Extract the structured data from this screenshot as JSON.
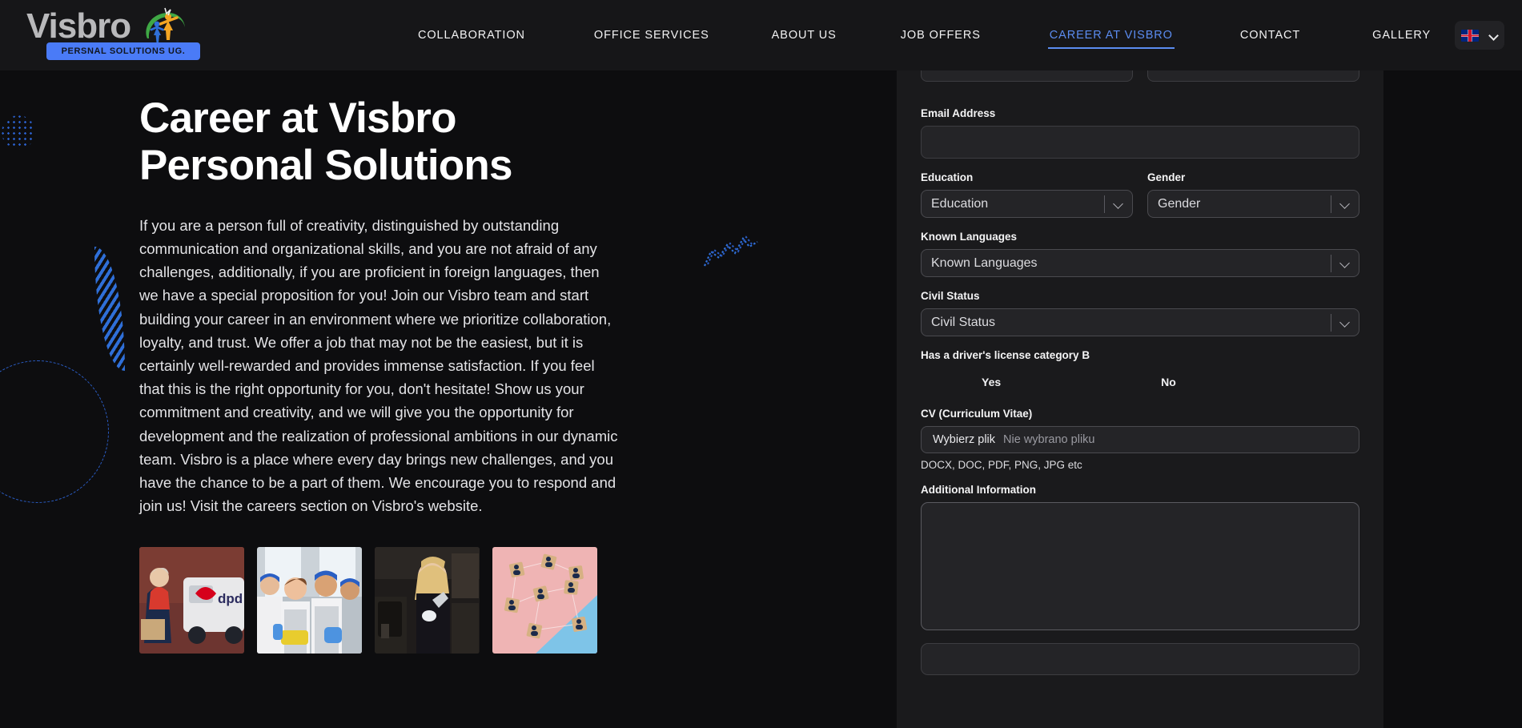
{
  "brand": {
    "logo_word": "Visbro",
    "logo_banner": "PERSNAL SOLUTIONS UG.",
    "accent_blue": "#4a7bf7",
    "active_nav_blue": "#5b8cf0"
  },
  "nav": {
    "items": [
      {
        "label": "COLLABORATION",
        "active": false
      },
      {
        "label": "OFFICE SERVICES",
        "active": false
      },
      {
        "label": "ABOUT US",
        "active": false
      },
      {
        "label": "JOB OFFERS",
        "active": false
      },
      {
        "label": "CAREER AT VISBRO",
        "active": true
      },
      {
        "label": "CONTACT",
        "active": false
      },
      {
        "label": "GALLERY",
        "active": false
      }
    ],
    "language": {
      "flag": "uk-flag-icon",
      "chevron": "chevron-down-icon"
    }
  },
  "hero": {
    "title": "Career at Visbro\nPersonal Solutions",
    "body": "If you are a person full of creativity, distinguished by outstanding communication and organizational skills, and you are not afraid of any challenges, additionally, if you are proficient in foreign languages, then we have a special proposition for you! Join our Visbro team and start building your career in an environment where we prioritize collaboration, loyalty, and trust. We offer a job that may not be the easiest, but it is certainly well-rewarded and provides immense satisfaction. If you feel that this is the right opportunity for you, don't hesitate! Show us your commitment and creativity, and we will give you the opportunity for development and the realization of professional ambitions in our dynamic team. Visbro is a place where every day brings new challenges, and you have the chance to be a part of them. We encourage you to respond and join us! Visit the careers section on Visbro's website."
  },
  "photos": [
    {
      "alt": "dpd-courier-photo",
      "label": "dpd"
    },
    {
      "alt": "cleaning-team-photo",
      "label": ""
    },
    {
      "alt": "barista-photo",
      "label": ""
    },
    {
      "alt": "hr-network-cubes-photo",
      "label": ""
    }
  ],
  "form": {
    "email": {
      "label": "Email Address",
      "value": "",
      "placeholder": ""
    },
    "education": {
      "label": "Education",
      "selected": "Education"
    },
    "gender": {
      "label": "Gender",
      "selected": "Gender"
    },
    "known_languages": {
      "label": "Known Languages",
      "selected": "Known Languages"
    },
    "civil_status": {
      "label": "Civil Status",
      "selected": "Civil Status"
    },
    "drivers_license": {
      "label": "Has a driver's license category B",
      "yes": "Yes",
      "no": "No"
    },
    "cv": {
      "label": "CV (Curriculum Vitae)",
      "button": "Wybierz plik",
      "filename": "Nie wybrano pliku",
      "hint": "DOCX, DOC, PDF, PNG, JPG etc"
    },
    "additional_information": {
      "label": "Additional Information",
      "value": ""
    }
  }
}
